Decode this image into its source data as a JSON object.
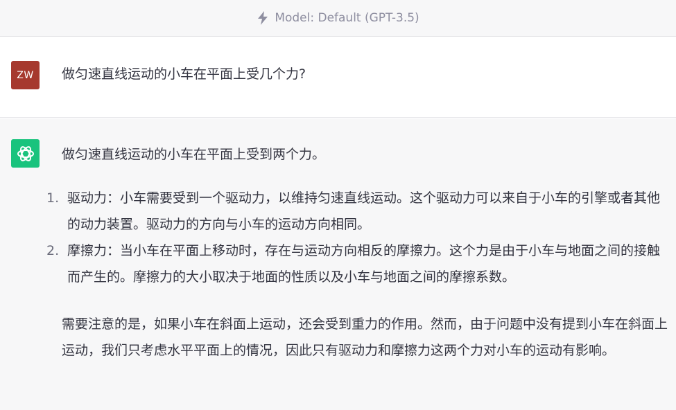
{
  "header": {
    "icon": "bolt-icon",
    "model_label": "Model: Default (GPT-3.5)"
  },
  "user_message": {
    "avatar_initials": "ZW",
    "avatar_color": "#a6392e",
    "text": "做匀速直线运动的小车在平面上受几个力?"
  },
  "assistant_message": {
    "avatar_icon": "openai-logo-icon",
    "avatar_color": "#19c37d",
    "intro": "做匀速直线运动的小车在平面上受到两个力。",
    "list": [
      {
        "number": "1.",
        "text": "驱动力：小车需要受到一个驱动力，以维持匀速直线运动。这个驱动力可以来自于小车的引擎或者其他的动力装置。驱动力的方向与小车的运动方向相同。"
      },
      {
        "number": "2.",
        "text": "摩擦力：当小车在平面上移动时，存在与运动方向相反的摩擦力。这个力是由于小车与地面之间的接触而产生的。摩擦力的大小取决于地面的性质以及小车与地面之间的摩擦系数。"
      }
    ],
    "note": "需要注意的是，如果小车在斜面上运动，还会受到重力的作用。然而，由于问题中没有提到小车在斜面上运动，我们只考虑水平平面上的情况，因此只有驱动力和摩擦力这两个力对小车的运动有影响。"
  }
}
